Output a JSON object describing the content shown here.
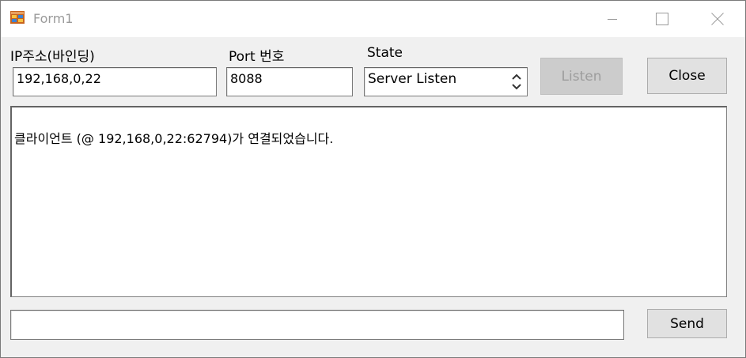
{
  "window": {
    "title": "Form1"
  },
  "labels": {
    "ip": "IP주소(바인딩)",
    "port": "Port 번호",
    "state": "State"
  },
  "fields": {
    "ip_value": "192,168,0,22",
    "port_value": "8088",
    "state_value": "Server Listen"
  },
  "buttons": {
    "listen": "Listen",
    "close": "Close",
    "send": "Send"
  },
  "log": {
    "lines": [
      "클라이언트 (@ 192,168,0,22:62794)가 연결되었습니다."
    ]
  },
  "message_input": {
    "value": ""
  },
  "icons": {
    "app": "form-app-icon",
    "minimize": "minimize-icon",
    "maximize": "maximize-icon",
    "close": "close-icon",
    "spinner": "spinner-arrows-icon"
  }
}
